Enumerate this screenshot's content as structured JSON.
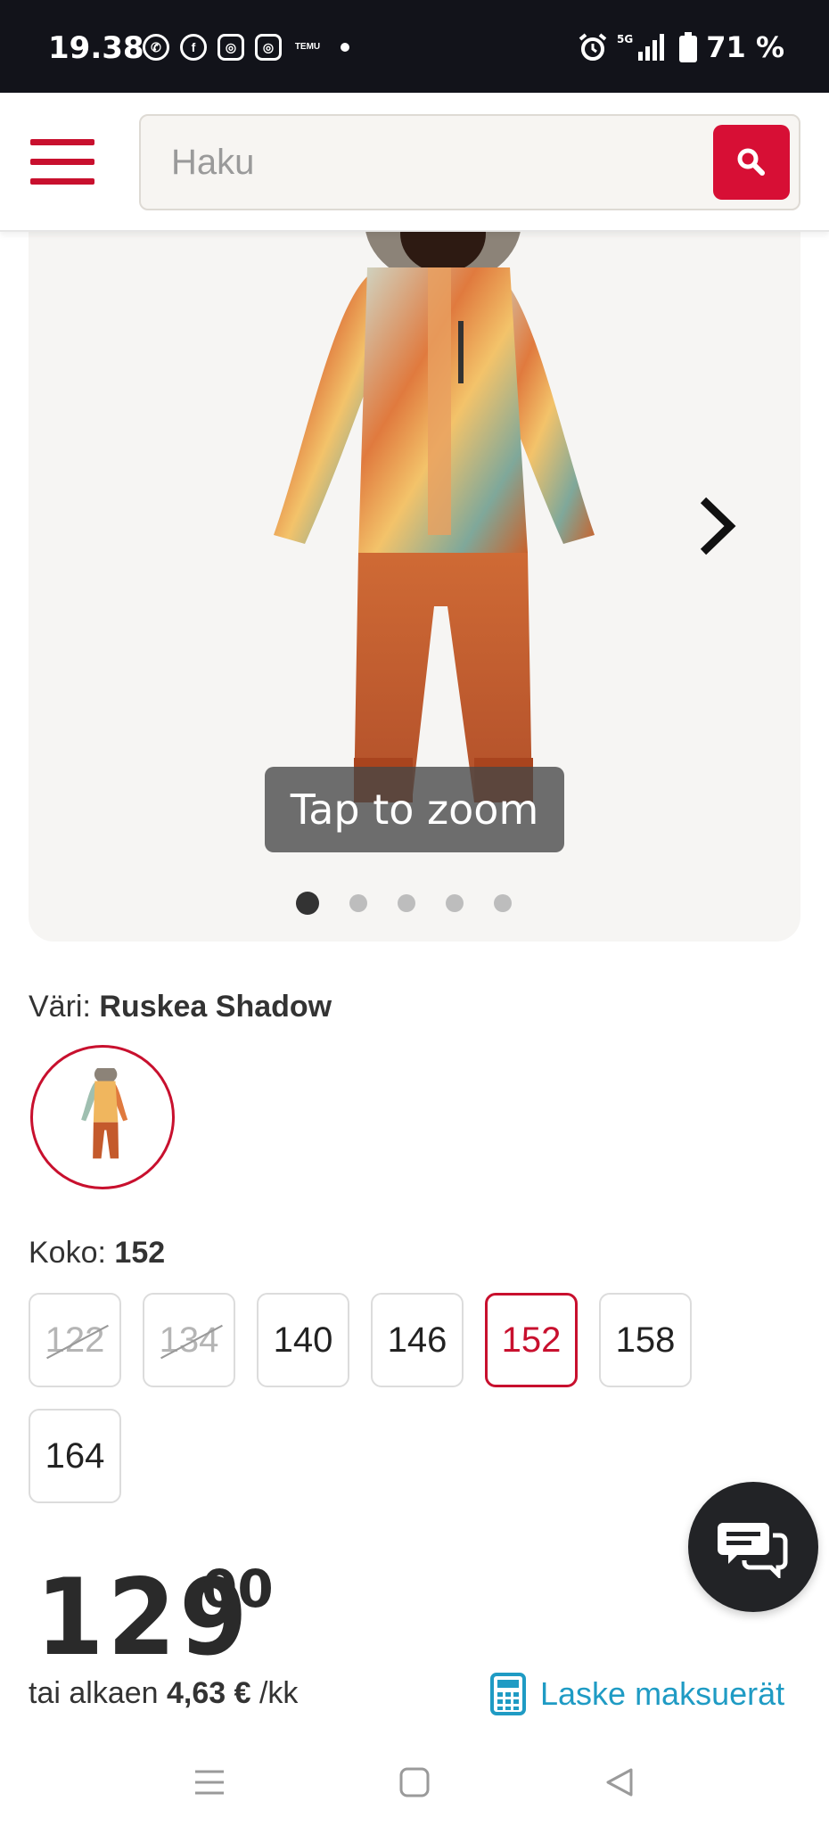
{
  "status_bar": {
    "time": "19.38",
    "network": "5G",
    "battery": "71 %",
    "app_icons": [
      "whatsapp-icon",
      "facebook-icon",
      "instagram-icon",
      "instagram-icon",
      "temu-icon"
    ],
    "temu_label": "TEMU"
  },
  "header": {
    "search_placeholder": "Haku"
  },
  "gallery": {
    "zoom_hint": "Tap to zoom",
    "image_count": 5,
    "active_index": 0
  },
  "color": {
    "label": "Väri:",
    "value": "Ruskea Shadow"
  },
  "size": {
    "label": "Koko:",
    "value": "152",
    "options": [
      {
        "label": "122",
        "state": "disabled"
      },
      {
        "label": "134",
        "state": "disabled"
      },
      {
        "label": "140",
        "state": "available"
      },
      {
        "label": "146",
        "state": "available"
      },
      {
        "label": "152",
        "state": "selected"
      },
      {
        "label": "158",
        "state": "available"
      },
      {
        "label": "164",
        "state": "available"
      }
    ]
  },
  "price": {
    "main": "129",
    "cents": "00"
  },
  "installment": {
    "prefix": "tai alkaen",
    "amount": "4,63 €",
    "suffix": "/kk",
    "calc_link": "Laske maksuerät"
  },
  "colors": {
    "accent": "#c8102e",
    "search_button": "#d70f35",
    "link": "#1f9bc4",
    "statusbar": "#12131a"
  }
}
